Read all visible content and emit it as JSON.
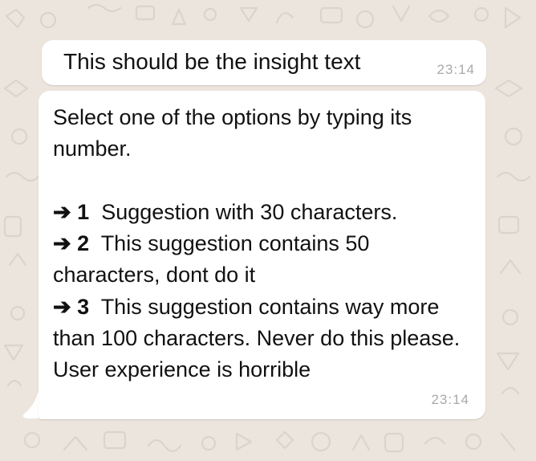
{
  "chat": {
    "background_color": "#ece5dd",
    "bubble_color": "#ffffff",
    "messages": [
      {
        "text": "This should be the insight text",
        "time": "23:14"
      },
      {
        "intro": "Select one of the options by typing its number.",
        "options": [
          {
            "arrow": "➔",
            "number": "1",
            "text": "Suggestion with 30 characters."
          },
          {
            "arrow": "➔",
            "number": "2",
            "text": "This suggestion contains 50 characters, dont do it"
          },
          {
            "arrow": "➔",
            "number": "3",
            "text": "This suggestion contains way more than 100 characters. Never do this please. User experience is horrible"
          }
        ],
        "time": "23:14"
      }
    ]
  }
}
